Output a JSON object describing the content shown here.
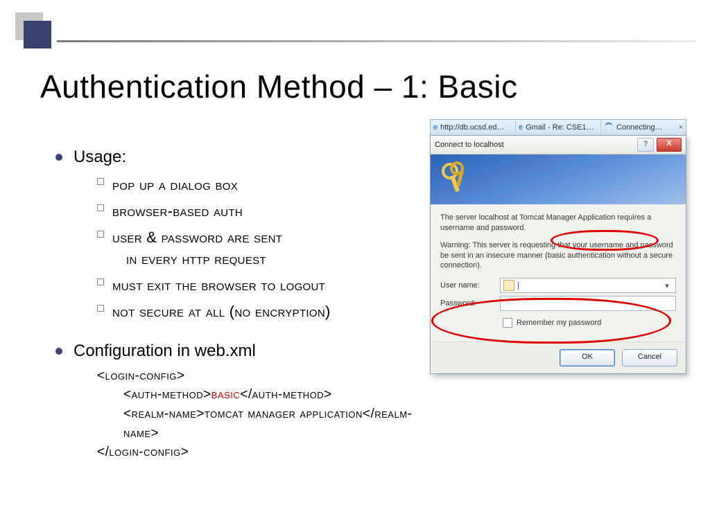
{
  "title": "Authentication Method – 1: Basic",
  "usage_heading": "Usage:",
  "usage_items": [
    "Pop up a dialog box",
    "Browser-based auth",
    "User & Password are sent",
    "in every http request",
    "Must exit the browser to logout",
    "Not secure at all (no encryption)"
  ],
  "config_heading": "Configuration in web.xml",
  "xml": {
    "open": "<login-config>",
    "line1_pre": "<auth-method>",
    "line1_val": "BASIC",
    "line1_post": "</auth-method>",
    "line2_pre": "<realm-name>",
    "line2_val": "Tomcat Manager Application",
    "line2_post": "</realm-name>",
    "close": "</login-config>"
  },
  "tabs": {
    "t1": "http://db.ucsd.ed…",
    "t2": "Gmail - Re: CSE1…",
    "t3": "Connecting…"
  },
  "dialog": {
    "title": "Connect to localhost",
    "help": "?",
    "close": "X",
    "para1a": "The server localhost at ",
    "para1b": "Tomcat Manager Application",
    "para1c": " requires a username and password.",
    "para2": "Warning: This server is requesting that your username and password be sent in an insecure manner (basic authentication without a secure connection).",
    "user_label": "User name:",
    "pass_label": "Password:",
    "user_caret": "|",
    "dropdown_glyph": "▾",
    "remember": "Remember my password",
    "ok": "OK",
    "cancel": "Cancel"
  }
}
